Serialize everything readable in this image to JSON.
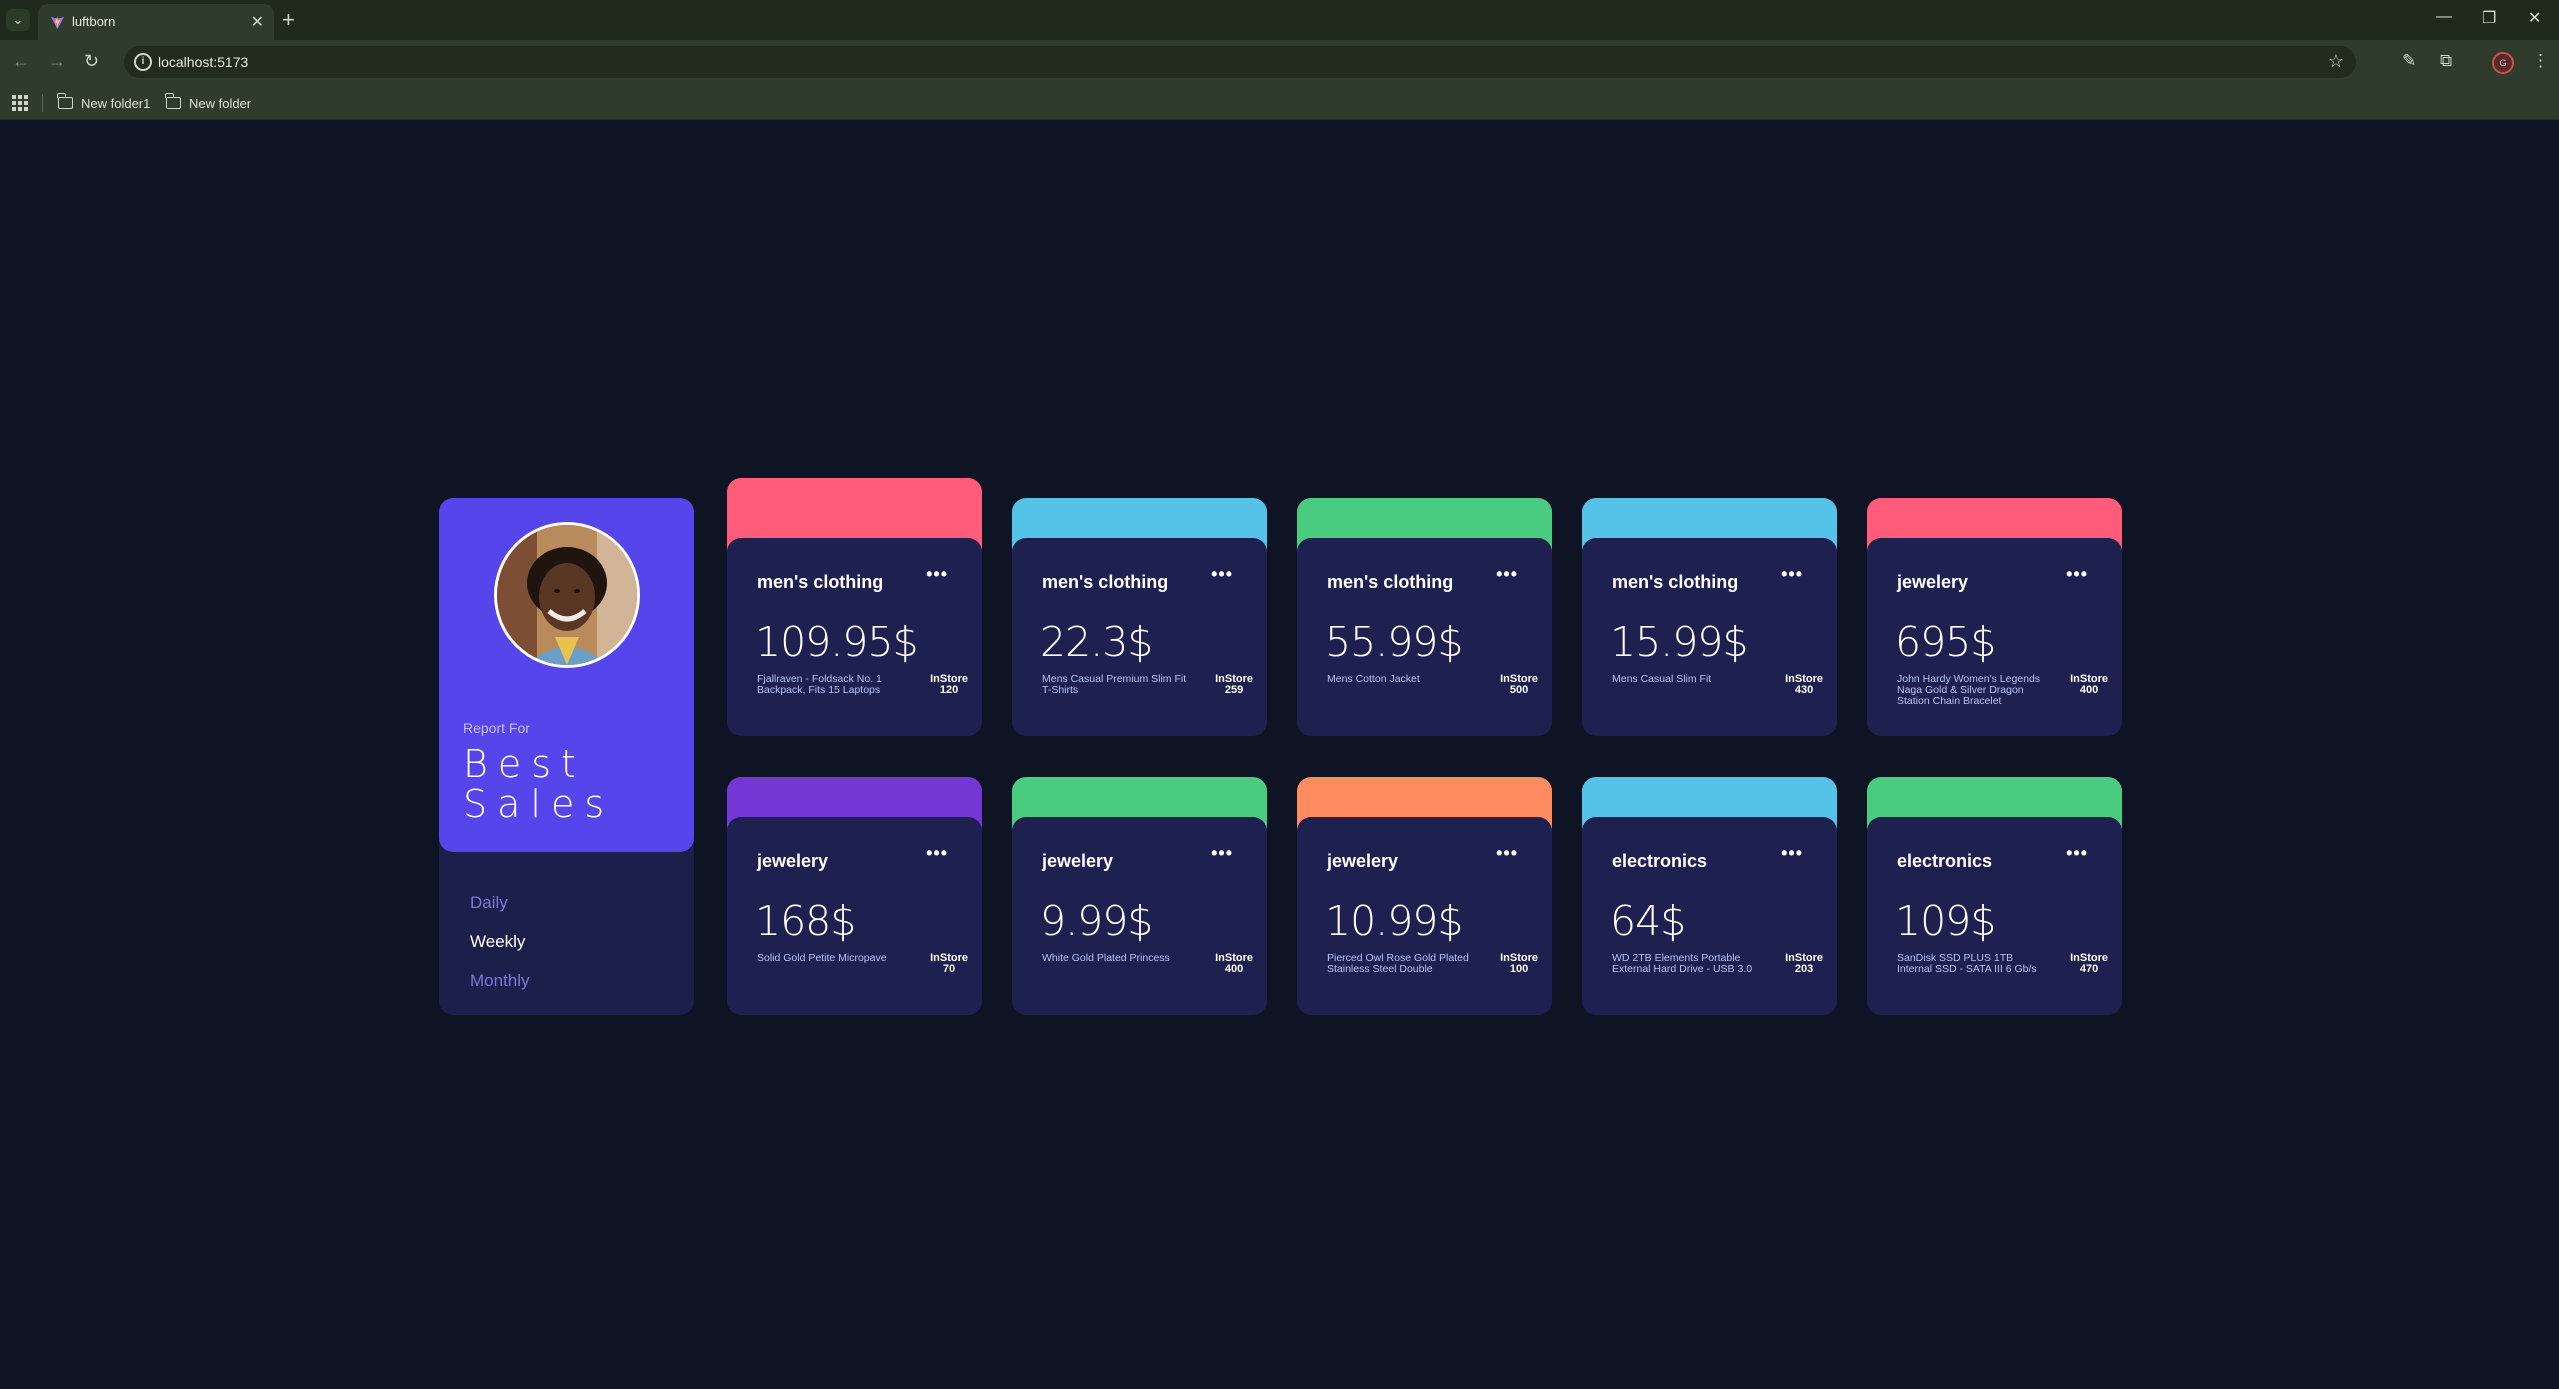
{
  "browser": {
    "tab_title": "luftborn",
    "url": "localhost:5173",
    "bookmarks": [
      "New folder1",
      "New folder"
    ],
    "profile_initial": "G"
  },
  "report": {
    "label": "Report For",
    "title_line1": "Best",
    "title_line2": "Sales",
    "periods": [
      "Daily",
      "Weekly",
      "Monthly"
    ],
    "active_period": "Weekly"
  },
  "instore_label": "InStore",
  "products": [
    {
      "category": "men's clothing",
      "price": "109.95$",
      "description": "Fjallraven - Foldsack No. 1 Backpack, Fits 15 Laptops",
      "stock": "120",
      "color": "#ff5c7a"
    },
    {
      "category": "men's clothing",
      "price": "22.3$",
      "description": "Mens Casual Premium Slim Fit T-Shirts",
      "stock": "259",
      "color": "#55c2e8"
    },
    {
      "category": "men's clothing",
      "price": "55.99$",
      "description": "Mens Cotton Jacket",
      "stock": "500",
      "color": "#4acc80"
    },
    {
      "category": "men's clothing",
      "price": "15.99$",
      "description": "Mens Casual Slim Fit",
      "stock": "430",
      "color": "#55c2e8"
    },
    {
      "category": "jewelery",
      "price": "695$",
      "description": "John Hardy Women's Legends Naga Gold & Silver Dragon Station Chain Bracelet",
      "stock": "400",
      "color": "#ff5c7a"
    },
    {
      "category": "jewelery",
      "price": "168$",
      "description": "Solid Gold Petite Micropave",
      "stock": "70",
      "color": "#7437d6"
    },
    {
      "category": "jewelery",
      "price": "9.99$",
      "description": "White Gold Plated Princess",
      "stock": "400",
      "color": "#4acc80"
    },
    {
      "category": "jewelery",
      "price": "10.99$",
      "description": "Pierced Owl Rose Gold Plated Stainless Steel Double",
      "stock": "100",
      "color": "#ff8b60"
    },
    {
      "category": "electronics",
      "price": "64$",
      "description": "WD 2TB Elements Portable External Hard Drive - USB 3.0",
      "stock": "203",
      "color": "#55c2e8"
    },
    {
      "category": "electronics",
      "price": "109$",
      "description": "SanDisk SSD PLUS 1TB Internal SSD - SATA III 6 Gb/s",
      "stock": "470",
      "color": "#4acc80"
    }
  ]
}
